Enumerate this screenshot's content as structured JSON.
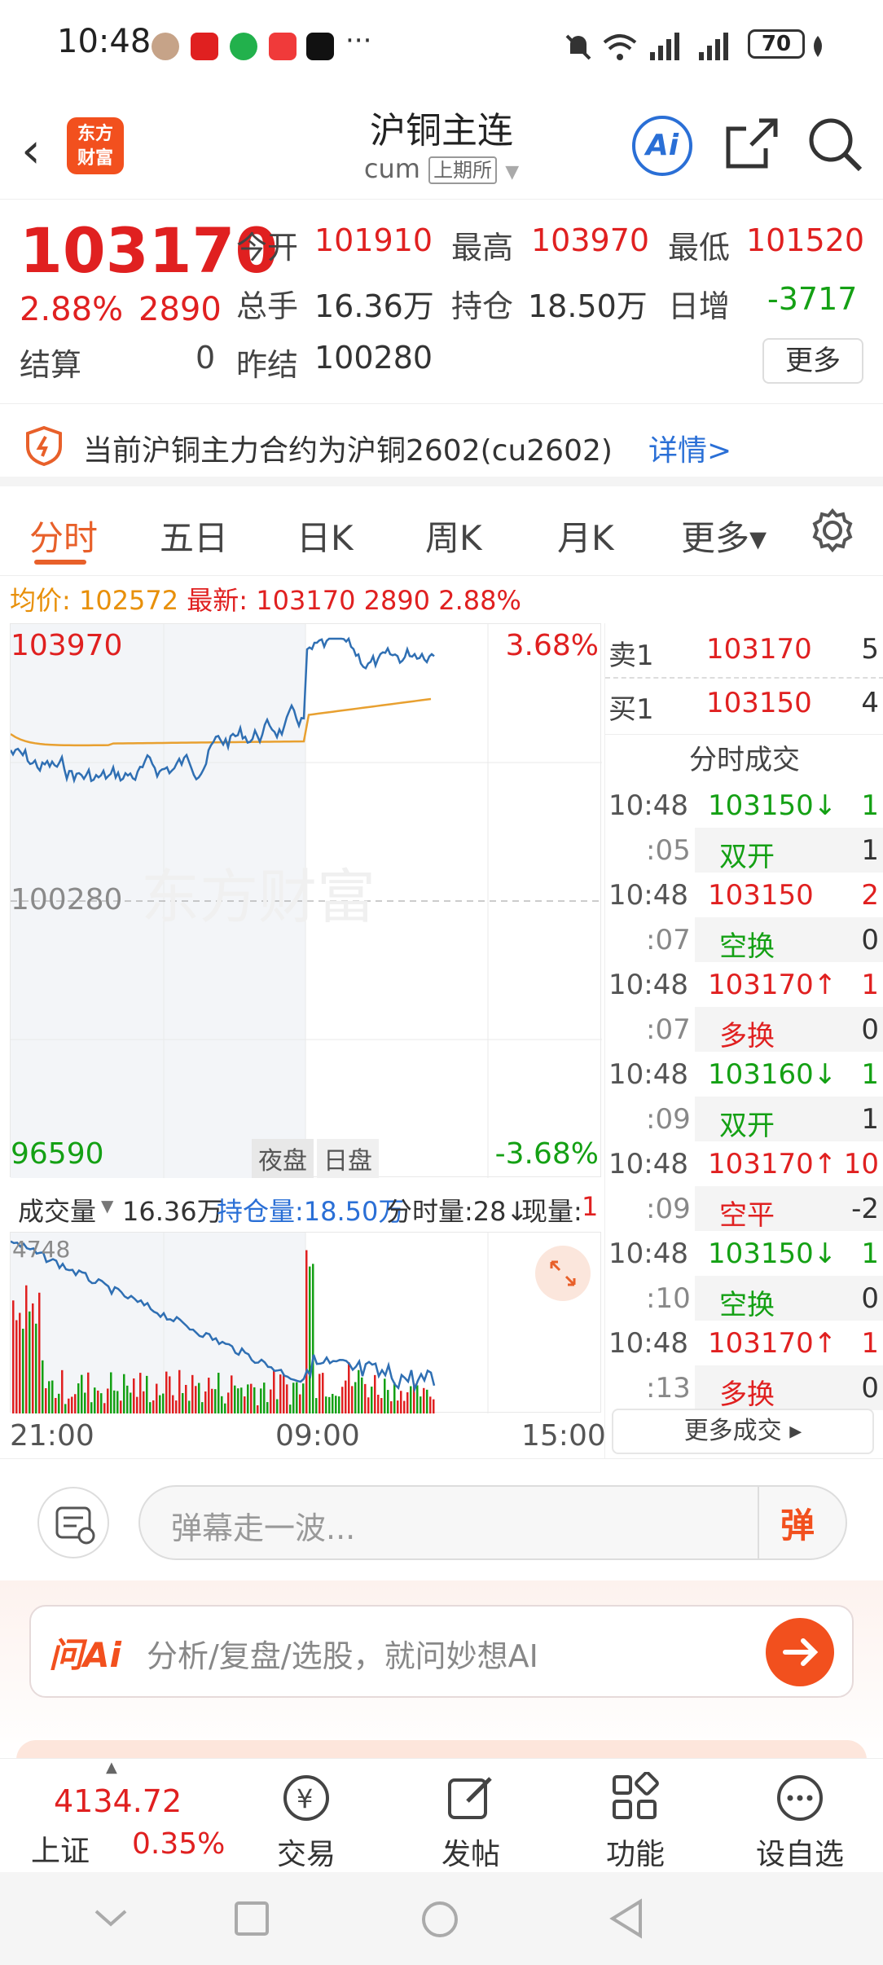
{
  "status_bar": {
    "time": "10:48",
    "more": "···",
    "battery": "70"
  },
  "header": {
    "back": "‹",
    "logo_line1": "东方",
    "logo_line2": "财富",
    "title": "沪铜主连",
    "code": "cum",
    "exchange": "上期所",
    "ai": "Ai"
  },
  "quote": {
    "price": "103170",
    "change_pct": "2.88%",
    "change": "2890",
    "settle_label": "结算",
    "settle_value": "0",
    "open_label": "今开",
    "open": "101910",
    "high_label": "最高",
    "high": "103970",
    "low_label": "最低",
    "low": "101520",
    "volume_label": "总手",
    "volume": "16.36万",
    "oi_label": "持仓",
    "oi": "18.50万",
    "daily_inc_label": "日增",
    "daily_inc": "-3717",
    "prev_settle_label": "昨结",
    "prev_settle": "100280",
    "more": "更多"
  },
  "notice": {
    "text": "当前沪铜主力合约为沪铜2602(cu2602)",
    "link": "详情>"
  },
  "tabs": [
    {
      "label": "分时"
    },
    {
      "label": "五日"
    },
    {
      "label": "日K"
    },
    {
      "label": "周K"
    },
    {
      "label": "月K"
    },
    {
      "label": "更多▾"
    }
  ],
  "avg_line": {
    "avg_label": "均价:",
    "avg": "102572",
    "last_label": "最新:",
    "last": "103170",
    "chg": "2890",
    "pct": "2.88%"
  },
  "chart": {
    "y_top": "103970",
    "y_top_pct": "3.68%",
    "y_mid": "100280",
    "y_bottom": "96590",
    "y_bottom_pct": "-3.68%",
    "night_tag": "夜盘",
    "day_tag": "日盘",
    "watermark": "东方财富",
    "vol_max": "4748",
    "x_ticks": [
      "21:00",
      "09:00",
      "15:00"
    ]
  },
  "volume_bar": {
    "label": "成交量",
    "volume": "16.36万",
    "oi": "持仓量:18.50万",
    "tick_vol": "分时量:28↓",
    "now_vol_label": "现量:",
    "now_vol": "1"
  },
  "order_book": [
    {
      "label": "卖1",
      "price": "103170",
      "vol": "5"
    },
    {
      "label": "买1",
      "price": "103150",
      "vol": "4"
    }
  ],
  "trades_title": "分时成交",
  "trades": [
    {
      "time": "10:48",
      "price": "103150↓",
      "dir": "down",
      "vol": "1",
      "sec": ":05",
      "type": "双开",
      "type_color": "green",
      "type_vol": "1"
    },
    {
      "time": "10:48",
      "price": "103150",
      "dir": "flat",
      "vol": "2",
      "sec": ":07",
      "type": "空换",
      "type_color": "green",
      "type_vol": "0"
    },
    {
      "time": "10:48",
      "price": "103170↑",
      "dir": "up",
      "vol": "1",
      "sec": ":07",
      "type": "多换",
      "type_color": "red",
      "type_vol": "0"
    },
    {
      "time": "10:48",
      "price": "103160↓",
      "dir": "down",
      "vol": "1",
      "sec": ":09",
      "type": "双开",
      "type_color": "green",
      "type_vol": "1"
    },
    {
      "time": "10:48",
      "price": "103170↑",
      "dir": "up",
      "vol": "10",
      "sec": ":09",
      "type": "空平",
      "type_color": "red",
      "type_vol": "-2"
    },
    {
      "time": "10:48",
      "price": "103150↓",
      "dir": "down",
      "vol": "1",
      "sec": ":10",
      "type": "空换",
      "type_color": "green",
      "type_vol": "0"
    },
    {
      "time": "10:48",
      "price": "103170↑",
      "dir": "up",
      "vol": "1",
      "sec": ":13",
      "type": "多换",
      "type_color": "red",
      "type_vol": "0"
    }
  ],
  "more_trades": "更多成交 ▸",
  "danmaku": {
    "placeholder": "弹幕走一波...",
    "send": "弹"
  },
  "ai_panel": {
    "logo": "问Ai",
    "placeholder": "分析/复盘/选股，就问妙想AI"
  },
  "bottom_nav": {
    "index_value": "4134.72",
    "index_name": "上证",
    "index_pct": "0.35%",
    "items": [
      {
        "label": "交易"
      },
      {
        "label": "发帖"
      },
      {
        "label": "功能"
      },
      {
        "label": "设自选"
      }
    ]
  },
  "colors": {
    "up": "#e02020",
    "down": "#14a014",
    "accent": "#e8602a",
    "price_line": "#2f6fb3",
    "avg_line": "#e8a030"
  }
}
